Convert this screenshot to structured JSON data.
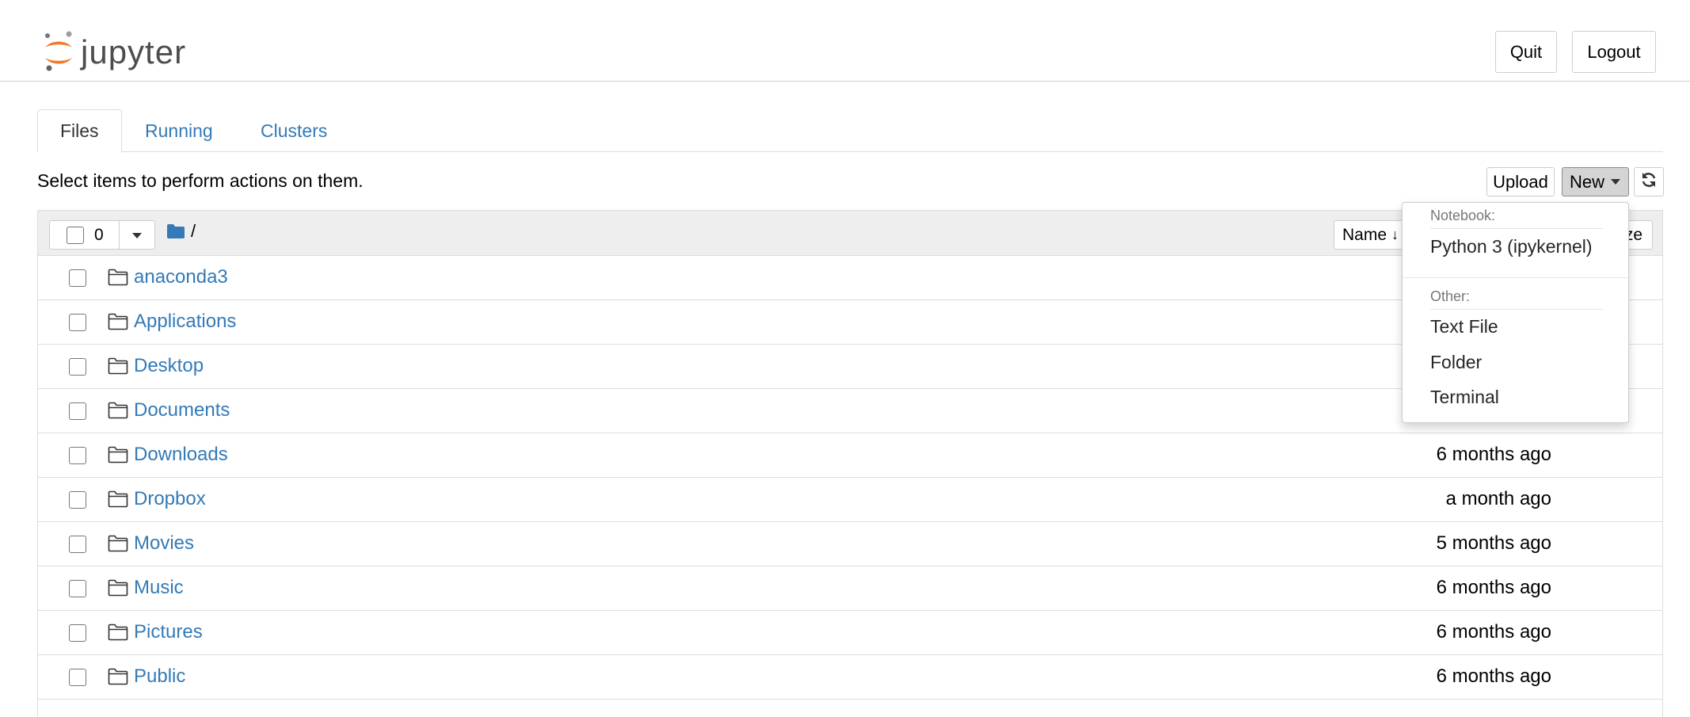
{
  "header": {
    "logo_text": "jupyter",
    "quit_label": "Quit",
    "logout_label": "Logout"
  },
  "tabs": [
    {
      "label": "Files",
      "active": true
    },
    {
      "label": "Running",
      "active": false
    },
    {
      "label": "Clusters",
      "active": false
    }
  ],
  "hint": "Select items to perform actions on them.",
  "toolbar": {
    "upload_label": "Upload",
    "new_label": "New",
    "refresh_icon": "refresh-icon"
  },
  "list_header": {
    "selected_count": "0",
    "path": "/",
    "sort_name_label": "Name",
    "size_label_partial": "ze"
  },
  "files": [
    {
      "name": "anaconda3",
      "modified": ""
    },
    {
      "name": "Applications",
      "modified": ""
    },
    {
      "name": "Desktop",
      "modified": ""
    },
    {
      "name": "Documents",
      "modified": ""
    },
    {
      "name": "Downloads",
      "modified": "6 months ago"
    },
    {
      "name": "Dropbox",
      "modified": "a month ago"
    },
    {
      "name": "Movies",
      "modified": "5 months ago"
    },
    {
      "name": "Music",
      "modified": "6 months ago"
    },
    {
      "name": "Pictures",
      "modified": "6 months ago"
    },
    {
      "name": "Public",
      "modified": "6 months ago"
    }
  ],
  "new_menu": {
    "notebook_header": "Notebook:",
    "notebook_item": "Python 3 (ipykernel)",
    "other_header": "Other:",
    "other_items": [
      "Text File",
      "Folder",
      "Terminal"
    ]
  },
  "colors": {
    "link": "#337ab7",
    "jupyter_orange": "#f37726",
    "header_border": "#cfcfcf"
  }
}
